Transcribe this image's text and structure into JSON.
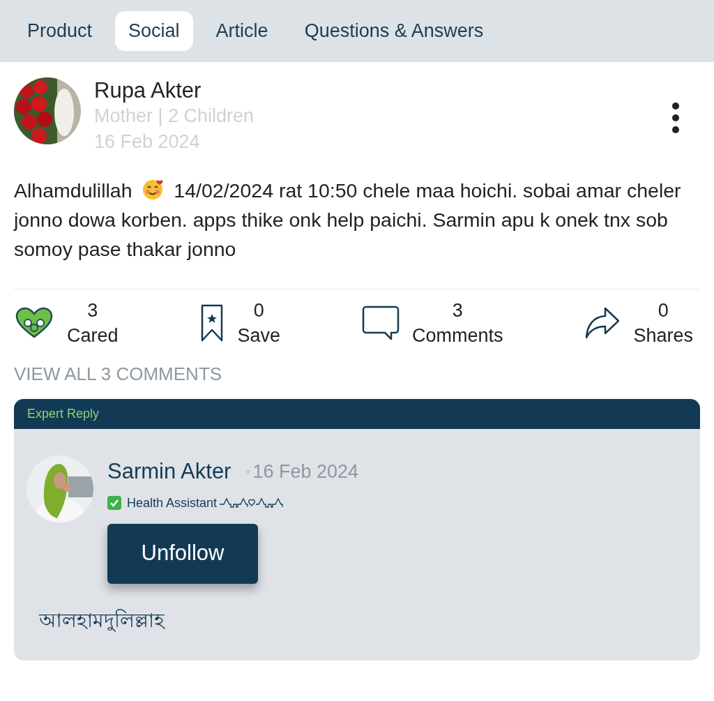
{
  "tabs": [
    {
      "label": "Product",
      "selected": false
    },
    {
      "label": "Social",
      "selected": true
    },
    {
      "label": "Article",
      "selected": false
    },
    {
      "label": "Questions & Answers",
      "selected": false
    }
  ],
  "post": {
    "author": "Rupa Akter",
    "subtitle": "Mother | 2 Children",
    "date": "16 Feb 2024",
    "body_lead": "Alhamdulillah",
    "body": "14/02/2024 rat 10:50 chele maa hoichi. sobai amar cheler jonno dowa korben. apps thike onk help paichi. Sarmin apu k onek tnx sob somoy pase thakar jonno"
  },
  "stats": [
    {
      "kind": "care",
      "count": "3",
      "label": "Cared"
    },
    {
      "kind": "save",
      "count": "0",
      "label": "Save"
    },
    {
      "kind": "comment",
      "count": "3",
      "label": "Comments"
    },
    {
      "kind": "share",
      "count": "0",
      "label": "Shares"
    }
  ],
  "view_all": "VIEW ALL 3 COMMENTS",
  "expert_reply": {
    "header": "Expert Reply",
    "name": "Sarmin Akter",
    "date": "16 Feb 2024",
    "role": "Health Assistant",
    "button": "Unfollow",
    "text": "আলহামদুলিল্লাহ"
  }
}
